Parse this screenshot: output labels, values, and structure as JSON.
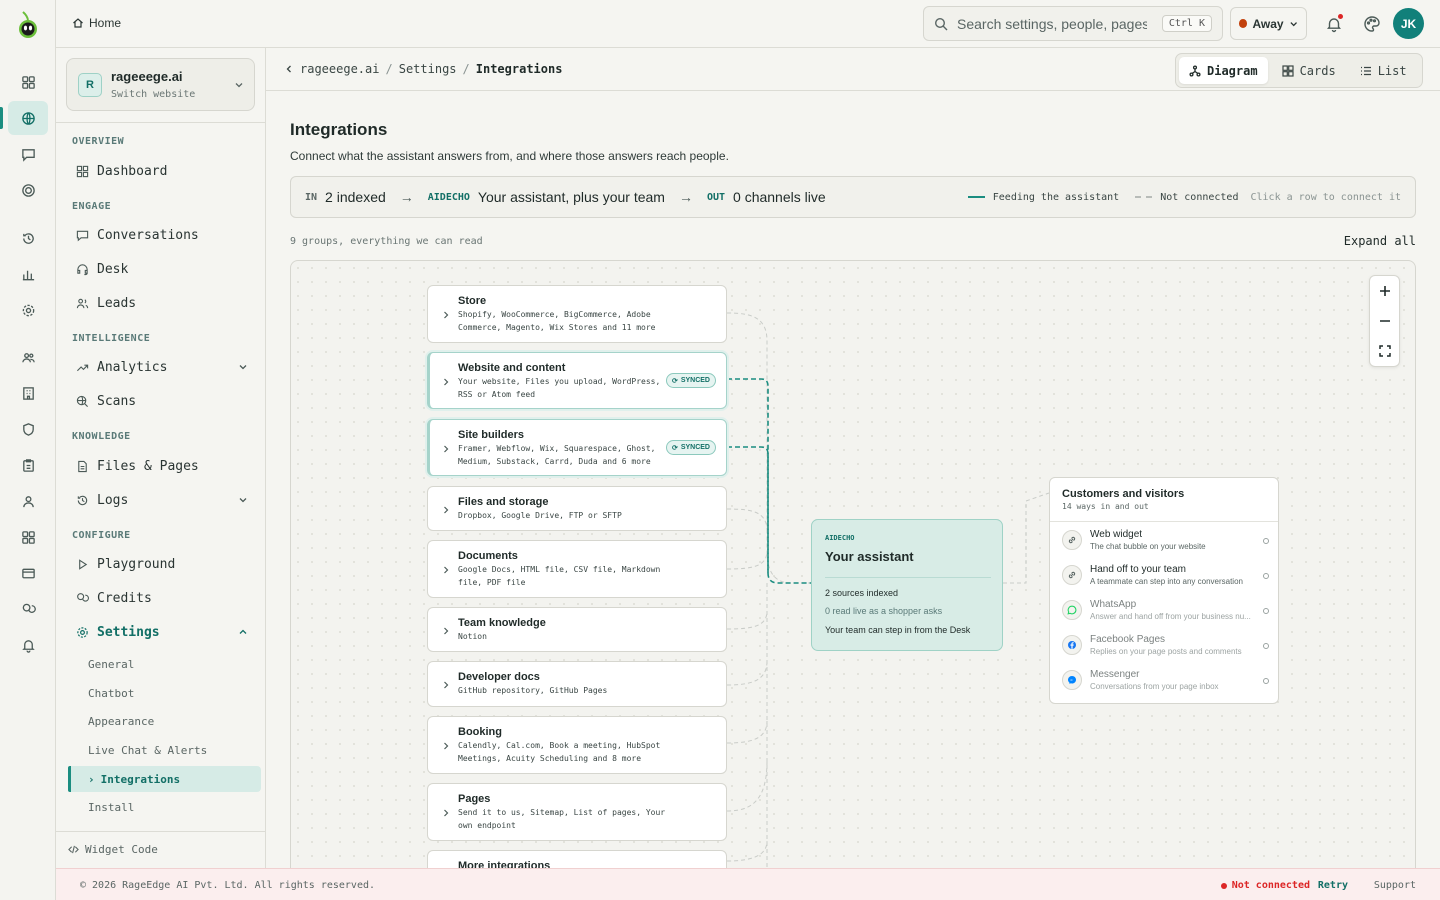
{
  "app": {
    "brand_icon": "alien-logo-icon"
  },
  "topbar": {
    "home_label": "Home",
    "search_placeholder": "Search settings, people, pages...",
    "search_shortcut": "Ctrl K",
    "status_label": "Away",
    "status_color": "#c2410c",
    "avatar_initials": "JK",
    "avatar_color": "#11807a"
  },
  "workspace": {
    "initial": "R",
    "name": "rageeege.ai",
    "subtitle": "Switch website"
  },
  "sidebar": {
    "sections": {
      "overview": "OVERVIEW",
      "engage": "ENGAGE",
      "intelligence": "INTELLIGENCE",
      "knowledge": "KNOWLEDGE",
      "configure": "CONFIGURE"
    },
    "items": {
      "dashboard": "Dashboard",
      "conversations": "Conversations",
      "desk": "Desk",
      "leads": "Leads",
      "analytics": "Analytics",
      "scans": "Scans",
      "files_pages": "Files & Pages",
      "logs": "Logs",
      "playground": "Playground",
      "credits": "Credits",
      "settings": "Settings"
    },
    "settings_sub": [
      "General",
      "Chatbot",
      "Appearance",
      "Live Chat & Alerts",
      "Integrations",
      "Install"
    ],
    "widget_code": "Widget Code"
  },
  "breadcrumb": {
    "items": [
      "rageeege.ai",
      "Settings",
      "Integrations"
    ],
    "separator": "/"
  },
  "views": {
    "diagram": "Diagram",
    "cards": "Cards",
    "list": "List",
    "active": "Diagram"
  },
  "page": {
    "title": "Integrations",
    "description": "Connect what the assistant answers from, and where those answers reach people."
  },
  "flow": {
    "in_tag": "IN",
    "in_text": "2 indexed",
    "mid_tag": "AIDECHO",
    "mid_text": "Your assistant, plus your team",
    "out_tag": "OUT",
    "out_text": "0 channels live",
    "legend_feeding": "Feeding the assistant",
    "legend_not_connected": "Not connected",
    "hint": "Click a row to connect it",
    "accent": "#1b8d80"
  },
  "groups_summary": "9 groups, everything we can read",
  "expand_all": "Expand all",
  "sources": [
    {
      "title": "Store",
      "subtitle": "Shopify, WooCommerce, BigCommerce, Adobe Commerce, Magento, Wix Stores and 11 more",
      "synced": false
    },
    {
      "title": "Website and content",
      "subtitle": "Your website, Files you upload, WordPress, RSS or Atom feed",
      "synced": true
    },
    {
      "title": "Site builders",
      "subtitle": "Framer, Webflow, Wix, Squarespace, Ghost, Medium, Substack, Carrd, Duda and 6 more",
      "synced": true
    },
    {
      "title": "Files and storage",
      "subtitle": "Dropbox, Google Drive, FTP or SFTP",
      "synced": false
    },
    {
      "title": "Documents",
      "subtitle": "Google Docs, HTML file, CSV file, Markdown file, PDF file",
      "synced": false
    },
    {
      "title": "Team knowledge",
      "subtitle": "Notion",
      "synced": false
    },
    {
      "title": "Developer docs",
      "subtitle": "GitHub repository, GitHub Pages",
      "synced": false
    },
    {
      "title": "Booking",
      "subtitle": "Calendly, Cal.com, Book a meeting, HubSpot Meetings, Acuity Scheduling and 8 more",
      "synced": false
    },
    {
      "title": "Pages",
      "subtitle": "Send it to us, Sitemap, List of pages, Your own endpoint",
      "synced": false
    },
    {
      "title": "More integrations",
      "subtitle": "",
      "synced": false
    }
  ],
  "synced_label": "SYNCED",
  "assistant": {
    "tag": "AIDECHO",
    "name": "Your assistant",
    "line1": "2 sources indexed",
    "line2": "0 read live as a shopper asks",
    "line3": "Your team can step in from the Desk"
  },
  "channels": {
    "title": "Customers and visitors",
    "subtitle": "14 ways in and out",
    "items": [
      {
        "name": "Web widget",
        "desc": "The chat bubble on your website",
        "icon": "link-icon"
      },
      {
        "name": "Hand off to your team",
        "desc": "A teammate can step into any conversation",
        "icon": "link-icon"
      },
      {
        "name": "WhatsApp",
        "desc": "Answer and hand off from your business nu...",
        "icon": "whatsapp-icon"
      },
      {
        "name": "Facebook Pages",
        "desc": "Replies on your page posts and comments",
        "icon": "facebook-icon"
      },
      {
        "name": "Messenger",
        "desc": "Conversations from your page inbox",
        "icon": "messenger-icon"
      }
    ]
  },
  "footer": {
    "copyright": "© 2026 RageEdge AI Pvt. Ltd. All rights reserved.",
    "connection": "Not connected",
    "retry": "Retry",
    "support": "Support"
  }
}
